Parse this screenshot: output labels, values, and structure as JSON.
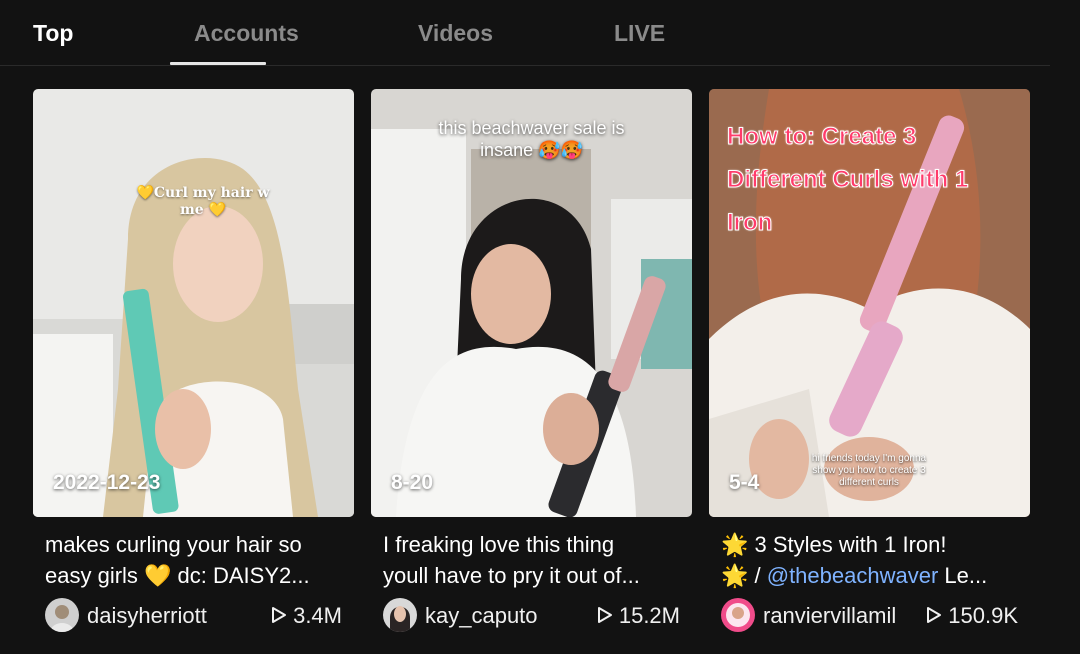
{
  "tabs": [
    {
      "label": "Top"
    },
    {
      "label": "Accounts"
    },
    {
      "label": "Videos"
    },
    {
      "label": "LIVE"
    }
  ],
  "videos": [
    {
      "overlay_line1": "💛Curl my hair w",
      "overlay_line2": "me 💛",
      "date": "2022-12-23",
      "desc_line1": "makes curling your hair so",
      "desc_line2": "easy girls 💛 dc: DAISY2...",
      "username": "daisyherriott",
      "views": "3.4M"
    },
    {
      "overlay_line1": "this beachwaver sale is",
      "overlay_line2": "insane 🥵🥵",
      "date": "8-20",
      "desc_line1": "I freaking love this thing",
      "desc_line2": "youll have to pry it out of...",
      "username": "kay_caputo",
      "views": "15.2M"
    },
    {
      "overlay_line1": "How to: Create 3",
      "overlay_line2": "Different Curls with 1",
      "overlay_line3": "Iron",
      "caption_line1": "hi friends today I'm gonna",
      "caption_line2": "show you how to create 3",
      "caption_line3": "different curls",
      "date": "5-4",
      "desc_line1": "🌟 3 Styles with 1 Iron!",
      "desc_line2_prefix": "🌟 / ",
      "desc_mention": "@thebeachwaver",
      "desc_line2_suffix": " Le...",
      "username": "ranviervillamil",
      "views": "150.9K"
    }
  ],
  "colors": {
    "background": "#121212",
    "active_tab": "#ffffff",
    "inactive_tab": "#8a8a8a",
    "mention": "#7fb3ff",
    "overlay_pink": "#ff3b6b"
  }
}
